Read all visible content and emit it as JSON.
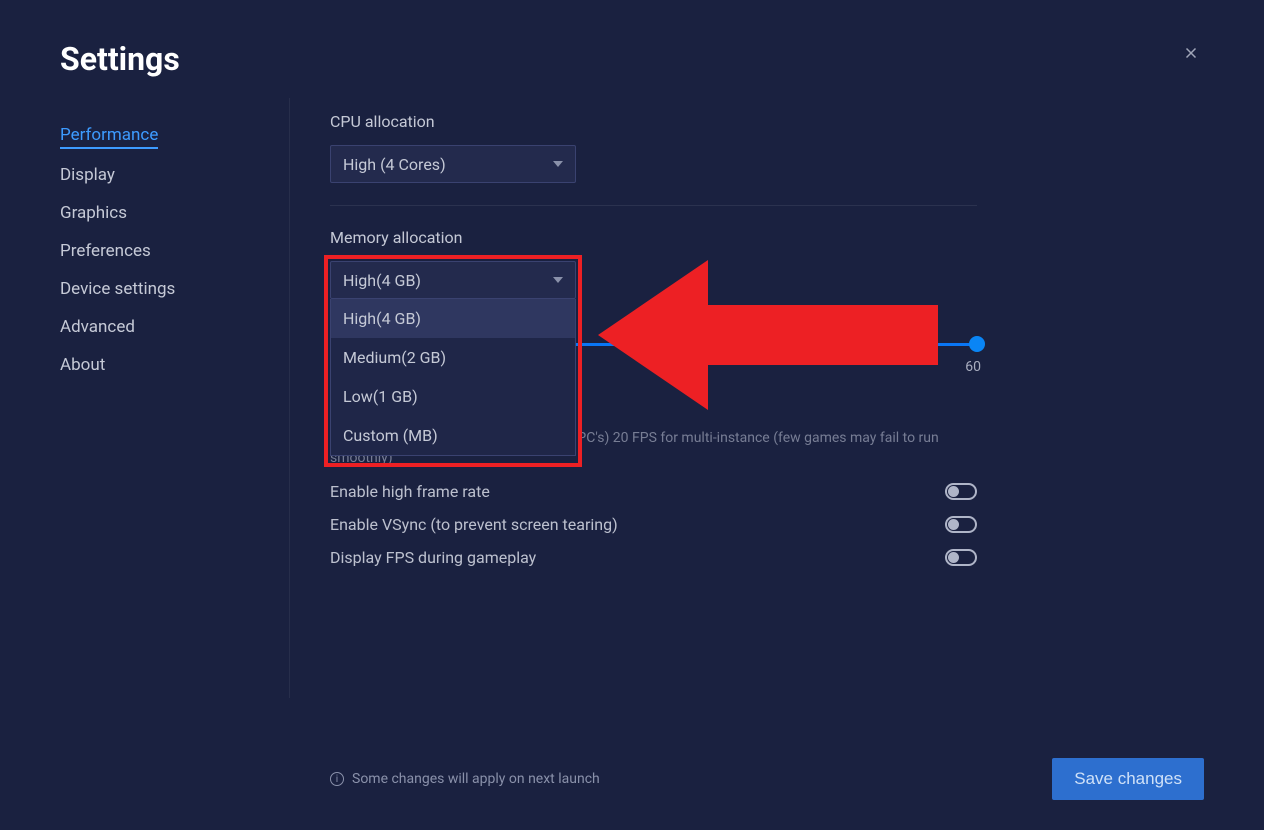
{
  "title": "Settings",
  "sidebar": {
    "items": [
      {
        "label": "Performance",
        "active": true
      },
      {
        "label": "Display",
        "active": false
      },
      {
        "label": "Graphics",
        "active": false
      },
      {
        "label": "Preferences",
        "active": false
      },
      {
        "label": "Device settings",
        "active": false
      },
      {
        "label": "Advanced",
        "active": false
      },
      {
        "label": "About",
        "active": false
      }
    ]
  },
  "cpu": {
    "label": "CPU allocation",
    "selected": "High (4 Cores)"
  },
  "memory": {
    "label": "Memory allocation",
    "selected": "High(4 GB)",
    "options": [
      "High(4 GB)",
      "Medium(2 GB)",
      "Low(1 GB)",
      "Custom (MB)"
    ]
  },
  "slider": {
    "max": "60"
  },
  "hint_partial": "effect performance on some entry level PC's) 20 FPS for multi-instance (few games may fail to run smoothly)",
  "toggles": {
    "hfr": "Enable high frame rate",
    "vsync": "Enable VSync (to prevent screen tearing)",
    "fps": "Display FPS during gameplay"
  },
  "footer": {
    "note": "Some changes will apply on next launch",
    "save": "Save changes"
  },
  "annotation": {
    "highlight_color": "#ed2024"
  }
}
